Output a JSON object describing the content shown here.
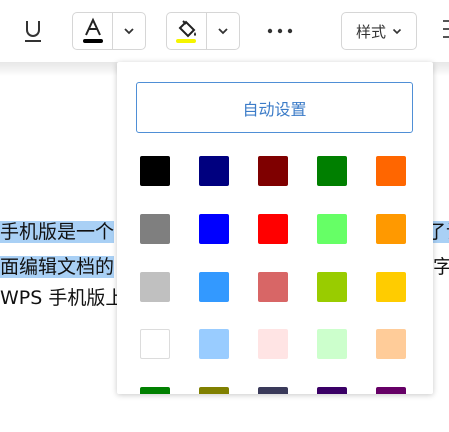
{
  "toolbar": {
    "style_label": "样式",
    "icons": {
      "underline": "underline-icon",
      "font_color": "font-color-icon",
      "highlight": "highlight-bucket-icon",
      "more": "more-horizontal-icon",
      "chevron": "chevron-down-icon"
    },
    "font_color_value": "#000000",
    "highlight_color_value": "#f5f500"
  },
  "document": {
    "line1_left": "手机版是一个",
    "line1_right": "了让",
    "line2_left": "面编辑文档的",
    "line2_right": "字",
    "line3_left": "WPS 手机版上"
  },
  "color_panel": {
    "auto_label": "自动设置",
    "swatches": [
      [
        "#000000",
        "#00007f",
        "#7f0000",
        "#007f00",
        "#ff6600"
      ],
      [
        "#7f7f7f",
        "#0000ff",
        "#ff0000",
        "#66ff66",
        "#ff9900"
      ],
      [
        "#c0c0c0",
        "#3399ff",
        "#d86666",
        "#99cc00",
        "#ffcc00"
      ],
      [
        "#ffffff",
        "#99ccff",
        "#ffe4e4",
        "#ccffcc",
        "#ffcc99"
      ],
      [
        "#008000",
        "#808000",
        "#3a3a5a",
        "#3a0066",
        "#660066"
      ]
    ]
  }
}
